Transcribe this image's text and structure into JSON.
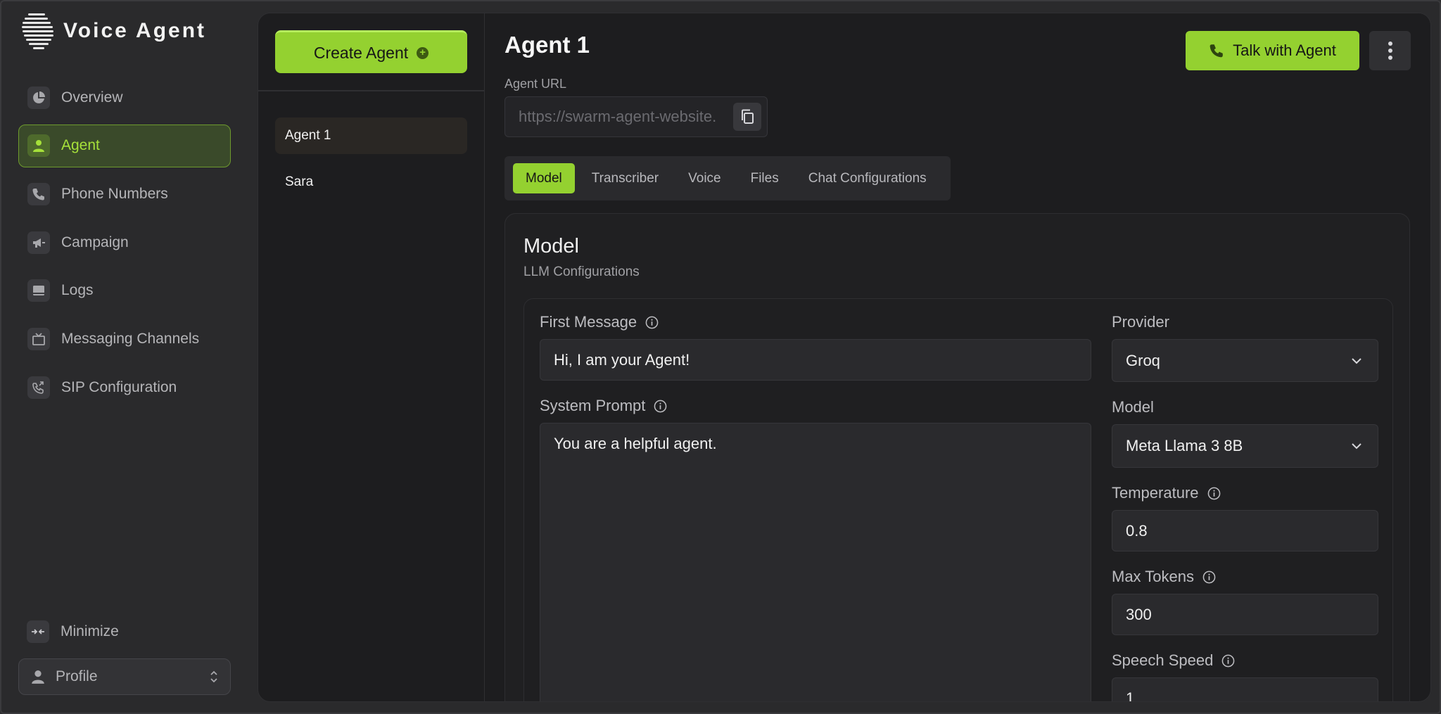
{
  "brand": {
    "name": "Voice Agent"
  },
  "sidebar": {
    "items": [
      {
        "label": "Overview",
        "icon": "pie-chart-icon",
        "active": false
      },
      {
        "label": "Agent",
        "icon": "person-icon",
        "active": true
      },
      {
        "label": "Phone Numbers",
        "icon": "phone-icon",
        "active": false
      },
      {
        "label": "Campaign",
        "icon": "megaphone-icon",
        "active": false
      },
      {
        "label": "Logs",
        "icon": "logs-icon",
        "active": false
      },
      {
        "label": "Messaging Channels",
        "icon": "tv-icon",
        "active": false
      },
      {
        "label": "SIP Configuration",
        "icon": "phone-forward-icon",
        "active": false
      }
    ],
    "minimize_label": "Minimize",
    "profile_label": "Profile"
  },
  "agents": {
    "create_label": "Create Agent",
    "list": [
      {
        "name": "Agent 1",
        "selected": true
      },
      {
        "name": "Sara",
        "selected": false
      }
    ]
  },
  "detail": {
    "title": "Agent 1",
    "talk_label": "Talk with Agent",
    "url_label": "Agent URL",
    "url_value": "https://swarm-agent-website.",
    "tabs": [
      {
        "label": "Model",
        "active": true
      },
      {
        "label": "Transcriber",
        "active": false
      },
      {
        "label": "Voice",
        "active": false
      },
      {
        "label": "Files",
        "active": false
      },
      {
        "label": "Chat Configurations",
        "active": false
      }
    ]
  },
  "model_section": {
    "title": "Model",
    "subtitle": "LLM Configurations",
    "first_message": {
      "label": "First Message",
      "value": "Hi, I am your Agent!"
    },
    "system_prompt": {
      "label": "System Prompt",
      "value": "You are a helpful agent."
    },
    "provider": {
      "label": "Provider",
      "value": "Groq"
    },
    "model": {
      "label": "Model",
      "value": "Meta Llama 3 8B"
    },
    "temperature": {
      "label": "Temperature",
      "value": "0.8"
    },
    "max_tokens": {
      "label": "Max Tokens",
      "value": "300"
    },
    "speech_speed": {
      "label": "Speech Speed",
      "value": "1"
    }
  },
  "colors": {
    "accent": "#94d130",
    "background": "#1d1d1f",
    "sidebar": "#2a2a2c"
  }
}
